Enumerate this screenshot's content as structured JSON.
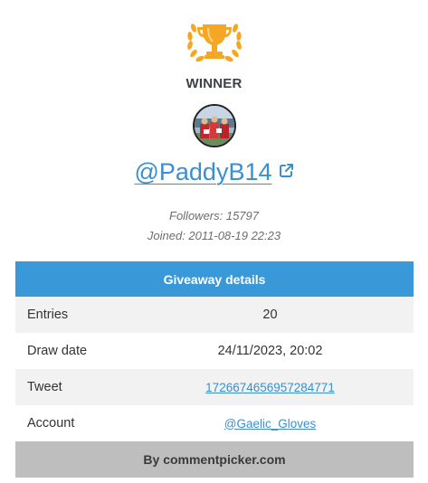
{
  "winner": {
    "label": "WINNER",
    "trophy_icon": "trophy-icon",
    "trophy_color": "#f5a623",
    "username": "@PaddyB14",
    "external_link_icon": "external-link-icon",
    "followers": "Followers: 15797",
    "joined": "Joined: 2011-08-19 22:23"
  },
  "details": {
    "title": "Giveaway details",
    "header_color": "#3898d8",
    "rows": [
      {
        "label": "Entries",
        "value": "20"
      },
      {
        "label": "Draw date",
        "value": "24/11/2023, 20:02"
      },
      {
        "label": "Tweet",
        "value": "1726674656957284771"
      },
      {
        "label": "Account",
        "value": "@Gaelic_Gloves"
      }
    ],
    "footer": "By commentpicker.com",
    "link_color": "#3a8fd0"
  }
}
